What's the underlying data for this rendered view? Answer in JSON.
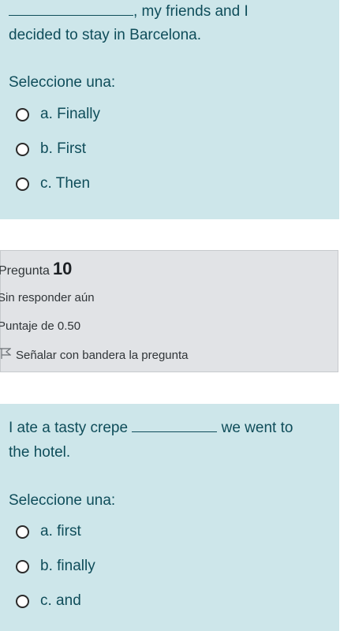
{
  "question_9": {
    "text_line1_after_blank": ", my friends and I",
    "text_line2": "decided to stay in Barcelona.",
    "prompt": "Seleccione una:",
    "options": [
      {
        "label": "a. Finally"
      },
      {
        "label": "b. First"
      },
      {
        "label": "c. Then"
      }
    ]
  },
  "question_10_info": {
    "pregunta_label": "Pregunta",
    "number": "10",
    "status": "Sin responder aún",
    "score": "Puntaje de 0.50",
    "flag_label": "Señalar con bandera la pregunta"
  },
  "question_10": {
    "text_before_blank": "I ate a tasty crepe",
    "text_after_blank": "we went to",
    "text_line2": "the hotel.",
    "prompt": "Seleccione una:",
    "options": [
      {
        "label": "a. first"
      },
      {
        "label": "b. finally"
      },
      {
        "label": "c. and"
      }
    ]
  }
}
